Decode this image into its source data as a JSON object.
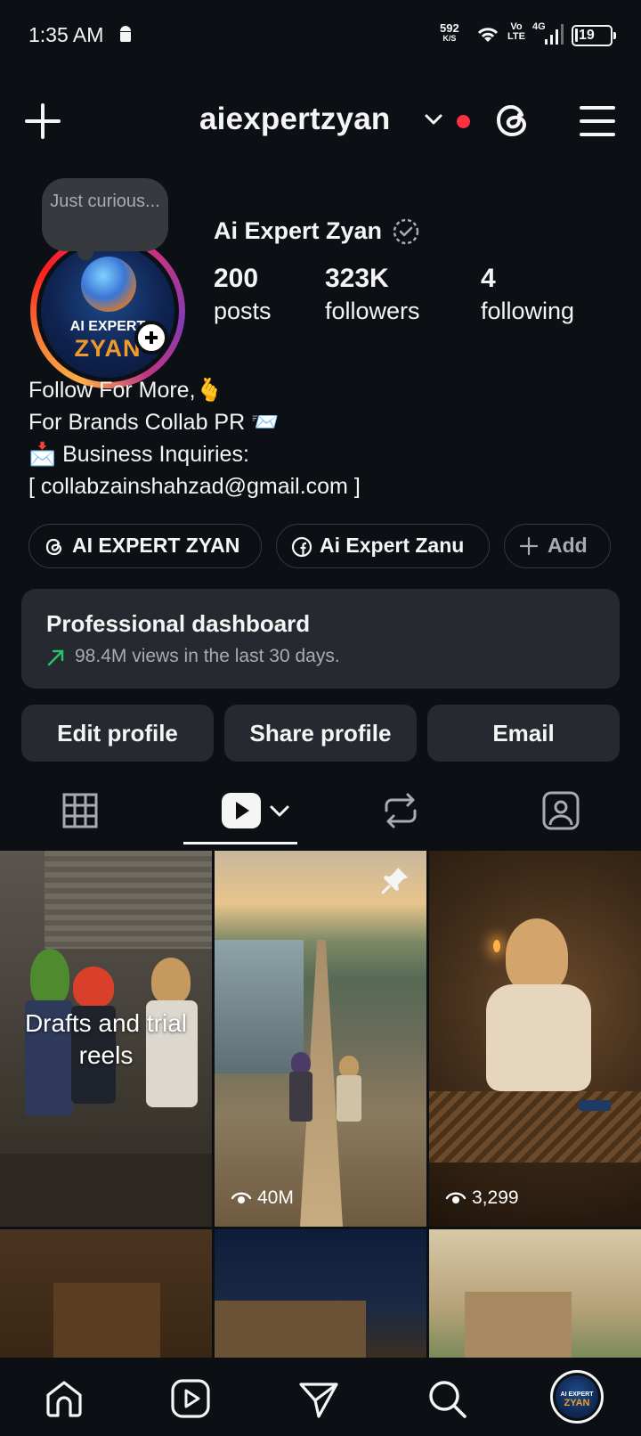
{
  "status_bar": {
    "time": "1:35 AM",
    "net_speed_value": "592",
    "net_speed_unit": "K/S",
    "volte_top": "Vo",
    "volte_bottom": "LTE",
    "network": "4G",
    "battery": "19"
  },
  "header": {
    "username": "aiexpertzyan"
  },
  "profile": {
    "note": "Just curious...",
    "display_name": "Ai Expert Zyan",
    "avatar_text_top": "AI EXPERT",
    "avatar_text_bottom": "ZYAN",
    "stats": [
      {
        "value": "200",
        "label": "posts"
      },
      {
        "value": "323K",
        "label": "followers"
      },
      {
        "value": "4",
        "label": "following"
      }
    ],
    "bio": [
      "Follow For More,🫰",
      "For Brands Collab PR 📨",
      "📩 Business Inquiries:",
      "[ collabzainshahzad@gmail.com ]"
    ],
    "links": [
      {
        "label": "AI EXPERT ZYAN",
        "icon": "threads-icon"
      },
      {
        "label": "Ai Expert Zanu",
        "icon": "facebook-icon"
      },
      {
        "label": "Add",
        "icon": "plus-icon"
      }
    ]
  },
  "dashboard": {
    "title": "Professional dashboard",
    "subtitle": "98.4M views in the last 30 days."
  },
  "actions": {
    "edit": "Edit profile",
    "share": "Share profile",
    "email": "Email"
  },
  "tabs": [
    "grid-icon",
    "reels-icon",
    "reposts-icon",
    "tagged-icon"
  ],
  "grid": {
    "drafts_label": "Drafts and trial reels",
    "items": [
      {
        "views": ""
      },
      {
        "views": "40M",
        "pinned": true
      },
      {
        "views": "3,299"
      }
    ]
  },
  "colors": {
    "background": "#0c1014",
    "surface": "#262a30",
    "live_dot": "#ff3040",
    "trend_green": "#29c56b",
    "muted_text": "#a8acb2"
  }
}
